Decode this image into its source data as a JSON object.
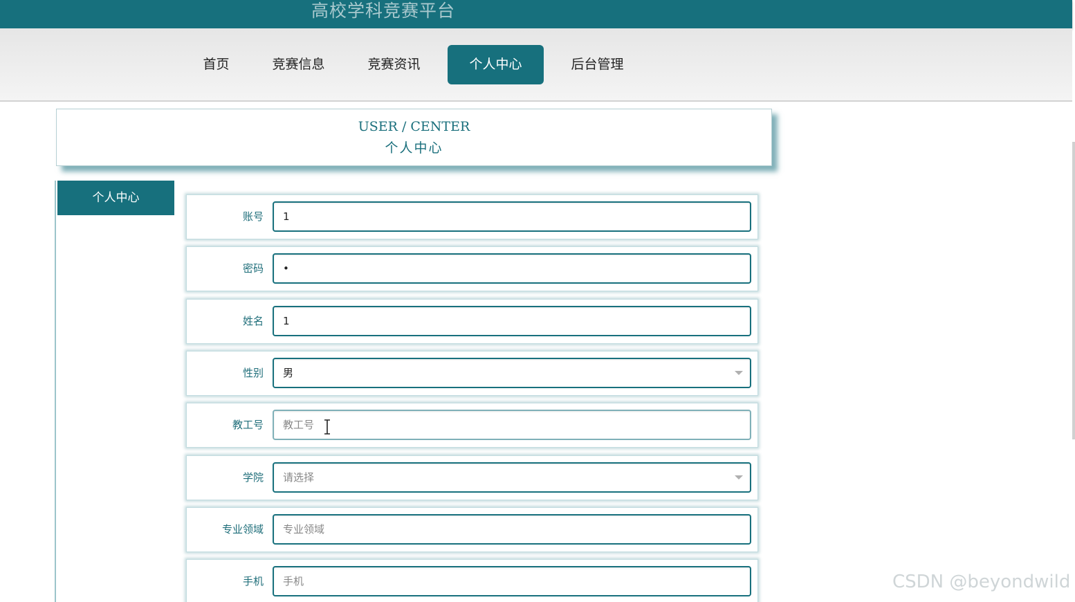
{
  "app": {
    "title": "高校学科竞赛平台"
  },
  "nav": {
    "items": [
      {
        "label": "首页"
      },
      {
        "label": "竞赛信息"
      },
      {
        "label": "竞赛资讯"
      },
      {
        "label": "个人中心",
        "active": true
      },
      {
        "label": "后台管理"
      }
    ]
  },
  "header": {
    "en": "USER / CENTER",
    "cn": "个人中心"
  },
  "sidebar": {
    "items": [
      {
        "label": "个人中心",
        "active": true
      }
    ]
  },
  "form": {
    "fields": [
      {
        "label": "账号",
        "value": "1",
        "type": "text"
      },
      {
        "label": "密码",
        "value": "•",
        "type": "password"
      },
      {
        "label": "姓名",
        "value": "1",
        "type": "text"
      },
      {
        "label": "性别",
        "value": "男",
        "type": "select"
      },
      {
        "label": "教工号",
        "placeholder": "教工号",
        "type": "text"
      },
      {
        "label": "学院",
        "placeholder": "请选择",
        "type": "select"
      },
      {
        "label": "专业领域",
        "placeholder": "专业领域",
        "type": "text"
      },
      {
        "label": "手机",
        "placeholder": "手机",
        "type": "text"
      }
    ]
  },
  "watermark": "CSDN @beyondwild",
  "colors": {
    "brand": "#17707d",
    "nav_bg": "#ececec",
    "text": "#222222"
  }
}
